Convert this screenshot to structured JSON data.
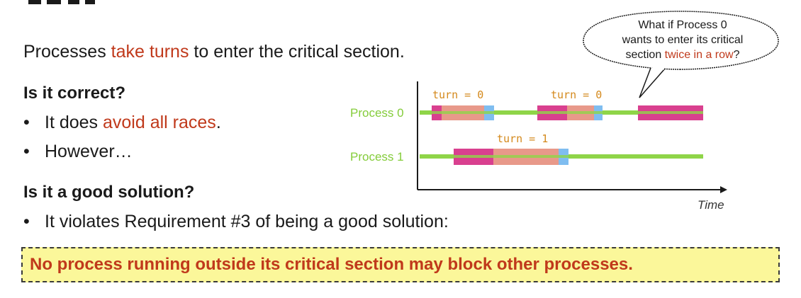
{
  "intro": {
    "before": "Processes ",
    "highlight": "take turns",
    "after": " to enter the critical section."
  },
  "section1": {
    "heading": "Is it correct?",
    "bullet1": {
      "before": "It does ",
      "highlight": "avoid all races",
      "after": "."
    },
    "bullet2": "However…"
  },
  "section2": {
    "heading": "Is it a good solution?",
    "bullet1": "It violates Requirement #3 of being a good solution:"
  },
  "banner": "No process running outside its critical section may block other processes.",
  "bubble": {
    "line1": "What if Process 0",
    "line2": "wants to enter its critical",
    "line3_before": "section ",
    "line3_highlight": "twice in a row",
    "line3_after": "?"
  },
  "timeline": {
    "process0": "Process 0",
    "process1": "Process 1",
    "turn0_a": "turn = 0",
    "turn0_b": "turn = 0",
    "turn1": "turn = 1",
    "time": "Time"
  },
  "colors": {
    "highlight": "#c0391b",
    "entry": "#d9408f",
    "critical": "#e8998a",
    "exit": "#7fbdf0",
    "remainder": "#8fd449",
    "banner_bg": "#fbf79a",
    "turn_label": "#d4891c"
  }
}
